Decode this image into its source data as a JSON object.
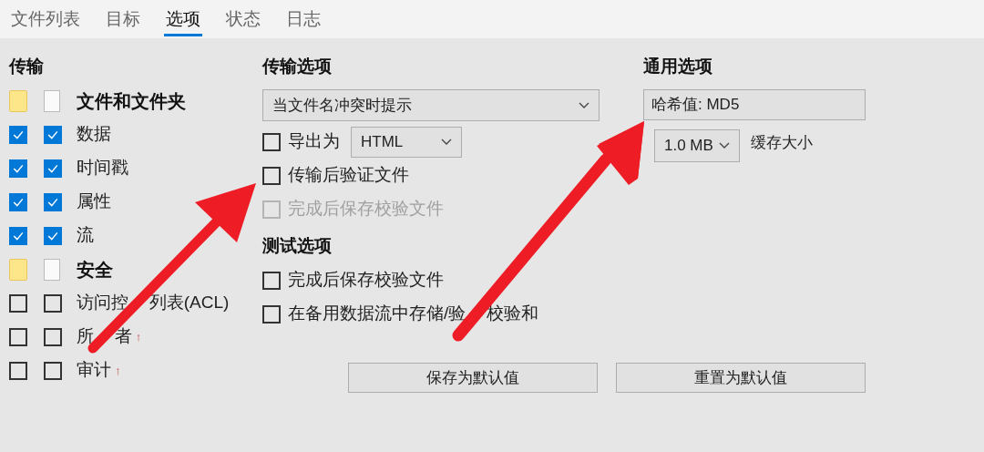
{
  "tabs": [
    {
      "label": "文件列表",
      "selected": false
    },
    {
      "label": "目标",
      "selected": false
    },
    {
      "label": "选项",
      "selected": true
    },
    {
      "label": "状态",
      "selected": false
    },
    {
      "label": "日志",
      "selected": false
    }
  ],
  "transfer": {
    "title": "传输",
    "items": [
      {
        "kind": "folder",
        "label": "文件和文件夹"
      },
      {
        "kind": "check",
        "checked_a": true,
        "checked_b": true,
        "label": "数据"
      },
      {
        "kind": "check",
        "checked_a": true,
        "checked_b": true,
        "label": "时间戳"
      },
      {
        "kind": "check",
        "checked_a": true,
        "checked_b": true,
        "label": "属性"
      },
      {
        "kind": "check",
        "checked_a": true,
        "checked_b": true,
        "label": "流"
      },
      {
        "kind": "folder",
        "label": "安全"
      },
      {
        "kind": "check",
        "checked_a": false,
        "checked_b": false,
        "label_parts": [
          "访问控",
          "列表(ACL)"
        ]
      },
      {
        "kind": "check",
        "checked_a": false,
        "checked_b": false,
        "label_parts": [
          "所",
          "者"
        ],
        "suffix": "↑"
      },
      {
        "kind": "check",
        "checked_a": false,
        "checked_b": false,
        "label": "审计",
        "suffix": "↑"
      }
    ]
  },
  "transfer_options": {
    "title": "传输选项",
    "conflict": "当文件名冲突时提示",
    "options": [
      {
        "kind": "export",
        "checked": false,
        "disabled": false,
        "label": "导出为",
        "format": "HTML"
      },
      {
        "kind": "check",
        "checked": false,
        "disabled": false,
        "label": "传输后验证文件"
      },
      {
        "kind": "check",
        "checked": false,
        "disabled": true,
        "label": "完成后保存校验文件"
      }
    ]
  },
  "test_options": {
    "title": "测试选项",
    "options": [
      {
        "kind": "check",
        "checked": false,
        "disabled": false,
        "label": "完成后保存校验文件"
      },
      {
        "kind": "check",
        "checked": false,
        "disabled": false,
        "label_parts": [
          "在备用数据流中存储/验",
          "校验和"
        ]
      }
    ]
  },
  "general": {
    "title": "通用选项",
    "hash": "哈希值: MD5",
    "buffer": "1.0 MB",
    "buffer_label": "缓存大小"
  },
  "buttons": [
    "保存为默认值",
    "重置为默认值"
  ]
}
